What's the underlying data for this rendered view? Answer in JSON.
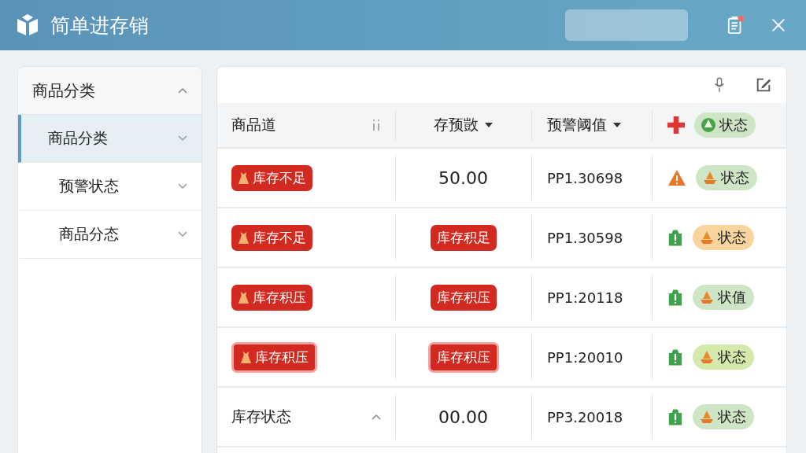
{
  "app": {
    "title": "简单进存销"
  },
  "sidebar": {
    "group": {
      "label": "商品分类",
      "expanded": true
    },
    "items": [
      {
        "label": "商品分类",
        "selected": true
      },
      {
        "label": "预警状态",
        "selected": false
      },
      {
        "label": "商品分态",
        "selected": false
      }
    ]
  },
  "table": {
    "columns": [
      {
        "label": "商品道"
      },
      {
        "label": "存预敳",
        "sortable": true
      },
      {
        "label": "预警阈值",
        "sortable": true
      },
      {
        "label": "状态",
        "color": "#cfe6c6"
      }
    ],
    "rows": [
      {
        "name": {
          "kind": "tag",
          "text": "库存不足",
          "highlighted": false
        },
        "stock": {
          "kind": "number",
          "text": "50.00"
        },
        "threshold": "PP1.30698",
        "alert": {
          "kind": "warning"
        },
        "status": {
          "text": "状态",
          "color": "#cfe6c6"
        }
      },
      {
        "name": {
          "kind": "tag",
          "text": "库存不足",
          "highlighted": false
        },
        "stock": {
          "kind": "tag",
          "text": "库存积足",
          "highlighted": false
        },
        "threshold": "PP1.30598",
        "alert": {
          "kind": "notice"
        },
        "status": {
          "text": "状态",
          "color": "#f8d49f"
        }
      },
      {
        "name": {
          "kind": "tag",
          "text": "库存积压",
          "highlighted": false
        },
        "stock": {
          "kind": "tag",
          "text": "库存积压",
          "highlighted": false
        },
        "threshold": "PP1:20118",
        "alert": {
          "kind": "notice"
        },
        "status": {
          "text": "状值",
          "color": "#cfe6c6"
        }
      },
      {
        "name": {
          "kind": "tag",
          "text": "库存积压",
          "highlighted": true
        },
        "stock": {
          "kind": "tag",
          "text": "库存积压",
          "highlighted": true
        },
        "threshold": "PP1:20010",
        "alert": {
          "kind": "notice"
        },
        "status": {
          "text": "状态",
          "color": "#d6e9ad"
        }
      },
      {
        "name": {
          "kind": "text",
          "text": "库存状态"
        },
        "stock": {
          "kind": "number",
          "text": "00.00"
        },
        "threshold": "PP3.20018",
        "alert": {
          "kind": "notice"
        },
        "status": {
          "text": "状态",
          "color": "#cfe6c6"
        }
      }
    ]
  }
}
